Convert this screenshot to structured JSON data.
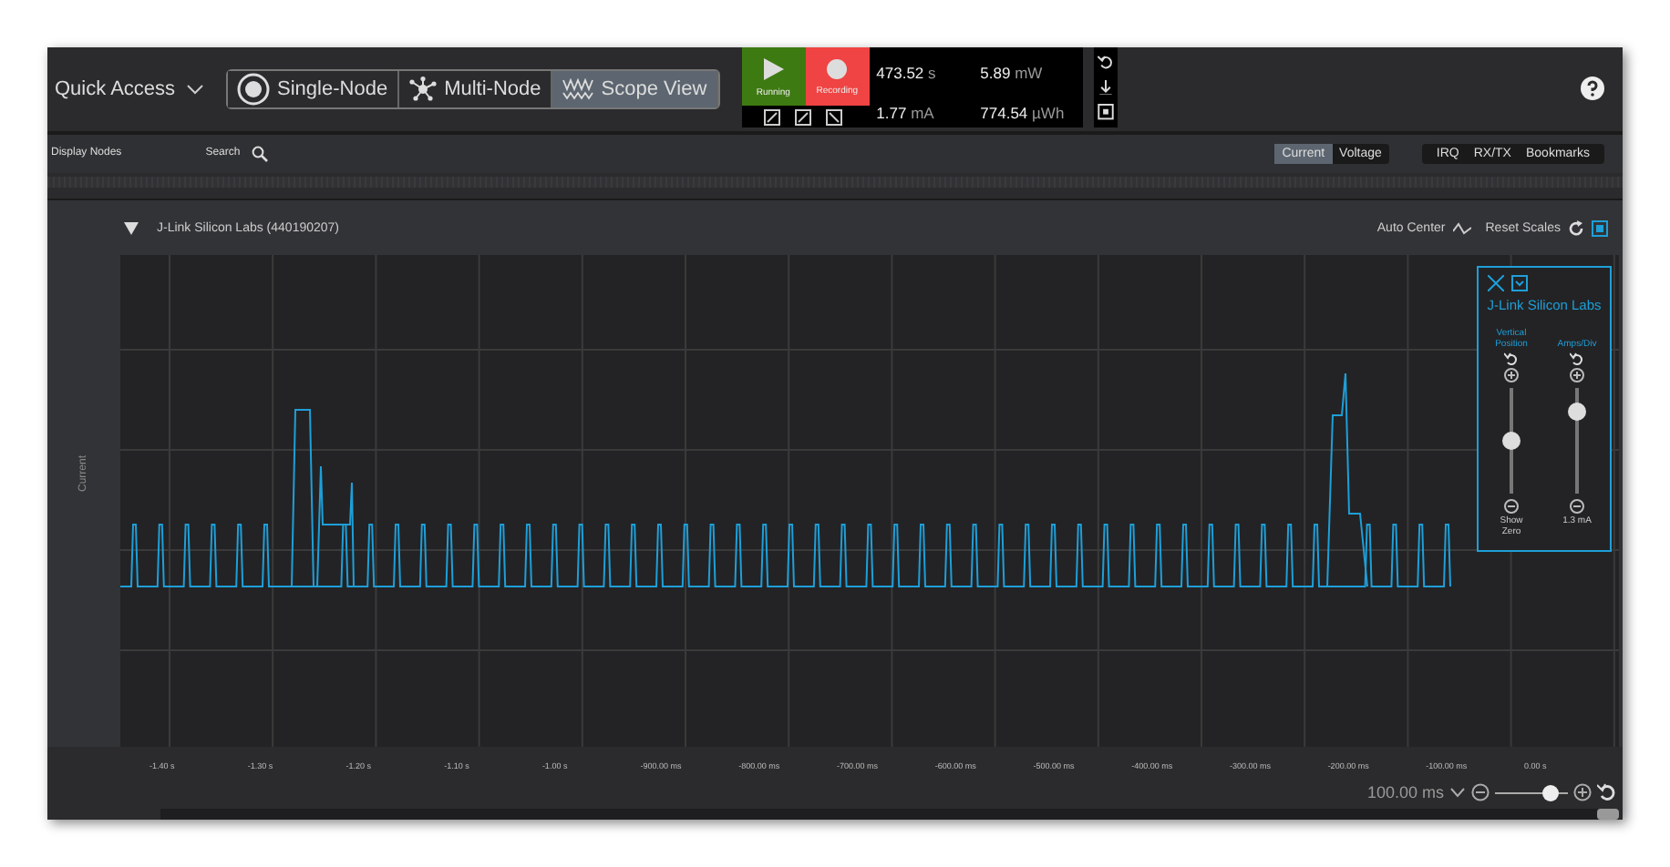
{
  "toolbar": {
    "quick_access": "Quick Access",
    "view_tabs": [
      {
        "label": "Single-Node",
        "selected": false,
        "kind": "single"
      },
      {
        "label": "Multi-Node",
        "selected": false,
        "kind": "multi"
      },
      {
        "label": "Scope View",
        "selected": true,
        "kind": "scope"
      }
    ],
    "run_button": {
      "label": "Running",
      "on": true
    },
    "record_button": {
      "label": "Recording",
      "on": true
    },
    "readings": [
      {
        "value": "473.52",
        "unit": "s"
      },
      {
        "value": "5.89",
        "unit": "mW"
      },
      {
        "value": "1.77",
        "unit": "mA"
      },
      {
        "value": "774.54",
        "unit": "µWh"
      }
    ]
  },
  "subbar": {
    "display_nodes": "Display Nodes",
    "search": "Search",
    "measure_tabs": [
      {
        "label": "Current",
        "selected": true
      },
      {
        "label": "Voltage",
        "selected": false
      }
    ],
    "overlays": [
      "IRQ",
      "RX/TX",
      "Bookmarks"
    ]
  },
  "panel": {
    "title": "J-Link Silicon Labs (440190207)",
    "expanded": true,
    "auto_center": "Auto Center",
    "reset_scales": "Reset Scales",
    "y_label": "Current",
    "legend": {
      "title": "J-Link Silicon Labs",
      "sliders": [
        {
          "label": "Vertical Position",
          "bottom": "Show Zero",
          "level": 0.5
        },
        {
          "label": "Amps/Div",
          "bottom": "1.3 mA",
          "level": 0.78
        }
      ]
    },
    "x_ticks": [
      "-1.40 s",
      "-1.30 s",
      "-1.20 s",
      "-1.10 s",
      "-1.00 s",
      "-900.00 ms",
      "-800.00 ms",
      "-700.00 ms",
      "-600.00 ms",
      "-500.00 ms",
      "-400.00 ms",
      "-300.00 ms",
      "-200.00 ms",
      "-100.00 ms",
      "0.00 s"
    ],
    "zoom": {
      "value": "100.00 ms",
      "level": 0.78
    }
  }
}
